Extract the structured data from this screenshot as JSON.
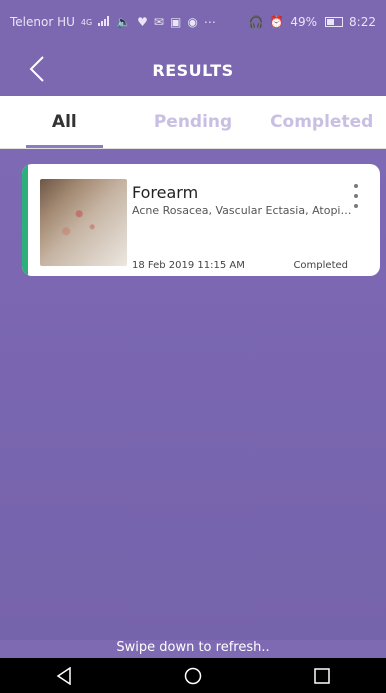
{
  "status_bar": {
    "carrier": "Telenor HU",
    "network": "4G",
    "icons_left": [
      "signal-icon",
      "volume-icon",
      "heart-icon",
      "mail-icon",
      "gallery-icon",
      "circle-icon",
      "more-icon"
    ],
    "battery": "49%",
    "time": "8:22"
  },
  "header": {
    "title": "RESULTS",
    "back_icon": "chevron-left-icon"
  },
  "tabs": [
    {
      "label": "All",
      "active": true
    },
    {
      "label": "Pending",
      "active": false
    },
    {
      "label": "Completed",
      "active": false
    }
  ],
  "results": [
    {
      "title": "Forearm",
      "description": "Acne Rosacea, Vascular Ectasia, Atopic...",
      "date": "18 Feb 2019 11:15 AM",
      "status": "Completed",
      "accent_color": "#2eae7a"
    }
  ],
  "footer": {
    "hint": "Swipe down to refresh.."
  },
  "colors": {
    "primary": "#7c68b0",
    "accent_green": "#2eae7a",
    "tab_inactive": "#c8bfe2"
  }
}
